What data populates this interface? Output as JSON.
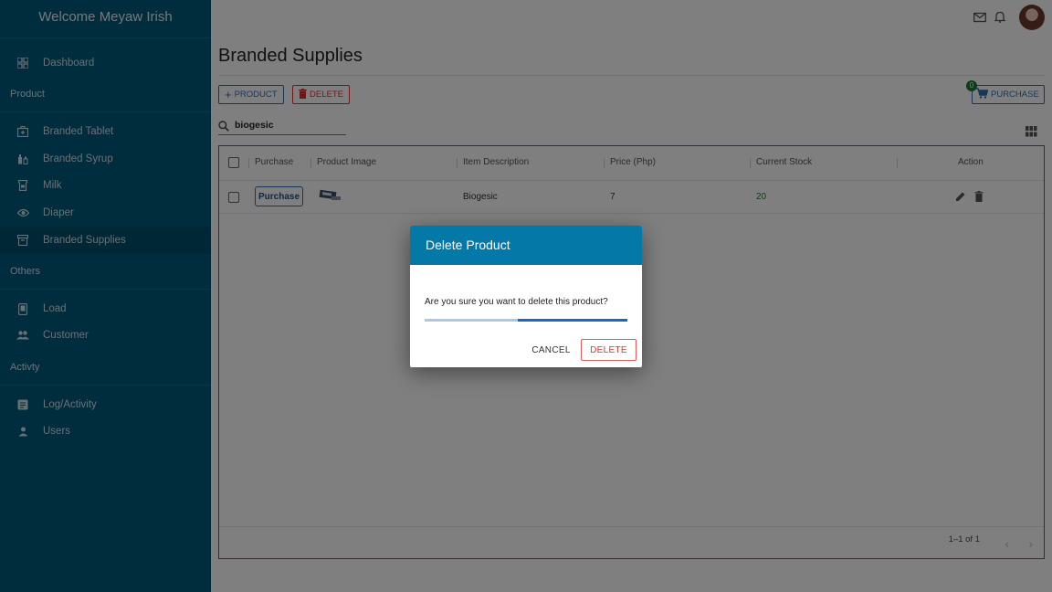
{
  "sidebar": {
    "welcome": "Welcome  Meyaw Irish",
    "dashboard": "Dashboard",
    "sections": {
      "product": "Product",
      "others": "Others",
      "activity": "Activty"
    },
    "product_items": [
      {
        "label": "Branded Tablet",
        "icon": "medkit-icon"
      },
      {
        "label": "Branded Syrup",
        "icon": "syrup-icon"
      },
      {
        "label": "Milk",
        "icon": "milk-icon"
      },
      {
        "label": "Diaper",
        "icon": "eye-icon"
      },
      {
        "label": "Branded Supplies",
        "icon": "archive-icon",
        "active": true
      }
    ],
    "other_items": [
      {
        "label": "Load",
        "icon": "phone-icon"
      },
      {
        "label": "Customer",
        "icon": "people-icon"
      }
    ],
    "activity_items": [
      {
        "label": "Log/Activity",
        "icon": "log-icon"
      },
      {
        "label": "Users",
        "icon": "person-icon"
      }
    ]
  },
  "page": {
    "title": "Branded Supplies",
    "add_label": "PRODUCT",
    "delete_label": "DELETE",
    "purchase_label": "PURCHASE",
    "cart_count": "0",
    "search_value": "biogesic"
  },
  "table": {
    "headers": [
      "Purchase",
      "Product Image",
      "Item Description",
      "Price (Php)",
      "Current Stock",
      "Action"
    ],
    "rows": [
      {
        "purchase": "Purchase",
        "description": "Biogesic",
        "price": "7",
        "stock": "20"
      }
    ],
    "pagination": "1–1 of 1"
  },
  "dialog": {
    "title": "Delete Product",
    "message": "Are you sure you want to delete this product?",
    "cancel": "CANCEL",
    "confirm": "DELETE",
    "progress": 0.46
  },
  "colors": {
    "sidebar": "#015a7c",
    "accent": "#0479a8",
    "primary_blue": "#2f6fb5",
    "danger": "#d33333",
    "stock_green": "#1d7a2f"
  }
}
